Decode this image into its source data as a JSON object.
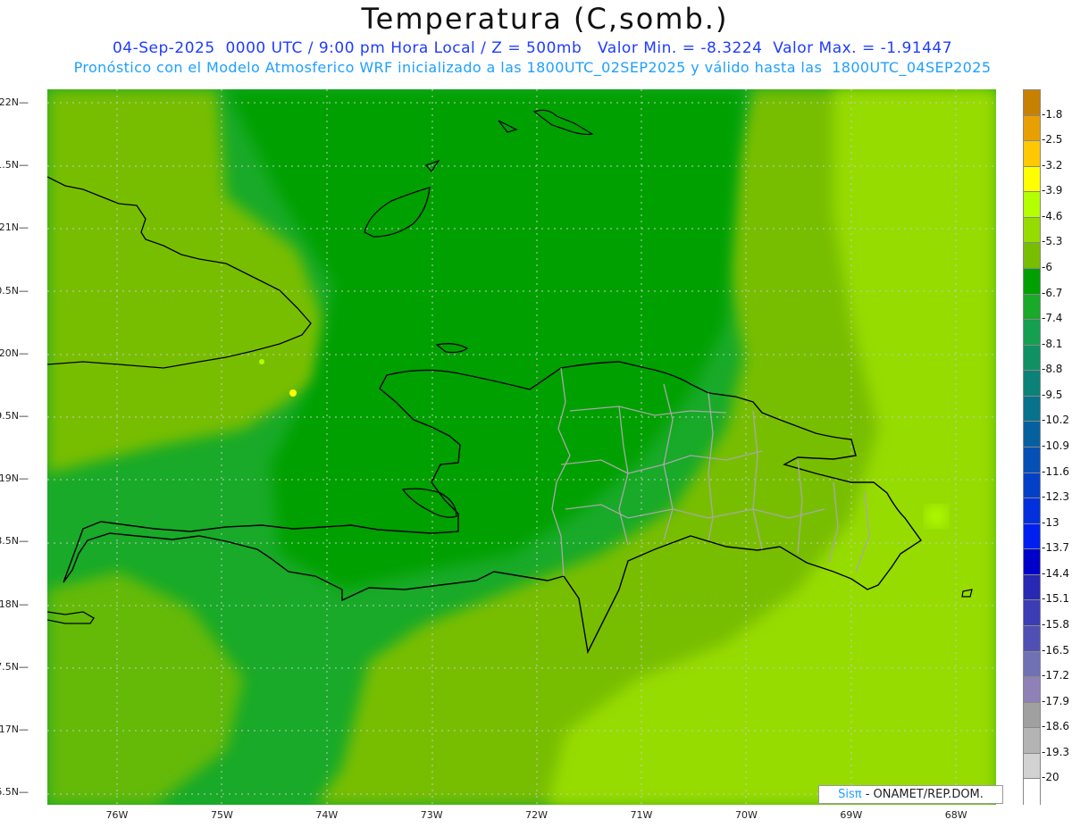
{
  "header": {
    "title": "Temperatura (C,somb.)",
    "subtitle_1": "04-Sep-2025  0000 UTC / 9:00 pm Hora Local / Z = 500mb   Valor Min. = -8.3224  Valor Max. = -1.91447",
    "subtitle_2": "Pronóstico con el Modelo Atmosferico WRF inicializado a las 1800UTC_02SEP2025 y válido hasta las  1800UTC_04SEP2025"
  },
  "axes": {
    "lat_labels": [
      "22N",
      "1.5N",
      "21N",
      "0.5N",
      "20N",
      "9.5N",
      "19N",
      "8.5N",
      "18N",
      "7.5N",
      "17N",
      "6.5N"
    ],
    "lon_labels": [
      "76W",
      "75W",
      "74W",
      "73W",
      "72W",
      "71W",
      "70W",
      "69W",
      "68W"
    ]
  },
  "colorbar": {
    "labels": [
      "-1.8",
      "-2.5",
      "-3.2",
      "-3.9",
      "-4.6",
      "-5.3",
      "-6",
      "-6.7",
      "-7.4",
      "-8.1",
      "-8.8",
      "-9.5",
      "-10.2",
      "-10.9",
      "-11.6",
      "-12.3",
      "-13",
      "-13.7",
      "-14.4",
      "-15.1",
      "-15.8",
      "-16.5",
      "-17.2",
      "-17.9",
      "-18.6",
      "-19.3",
      "-20"
    ],
    "colors": [
      "#c88000",
      "#e8a000",
      "#ffc800",
      "#ffff00",
      "#b4ff00",
      "#96dc00",
      "#78be00",
      "#00a000",
      "#18aa28",
      "#14a050",
      "#0f9164",
      "#0a8278",
      "#07728c",
      "#0560a0",
      "#0450b4",
      "#0340c8",
      "#0230dc",
      "#0120f0",
      "#0000c8",
      "#2828b4",
      "#3c3cb4",
      "#5050b4",
      "#7070b4",
      "#9080b8",
      "#a0a0a0",
      "#b4b4b4",
      "#d2d2d2",
      "#ffffff"
    ]
  },
  "credit": {
    "brand": "Sisπ",
    "text": " - ONAMET/REP.DOM."
  }
}
